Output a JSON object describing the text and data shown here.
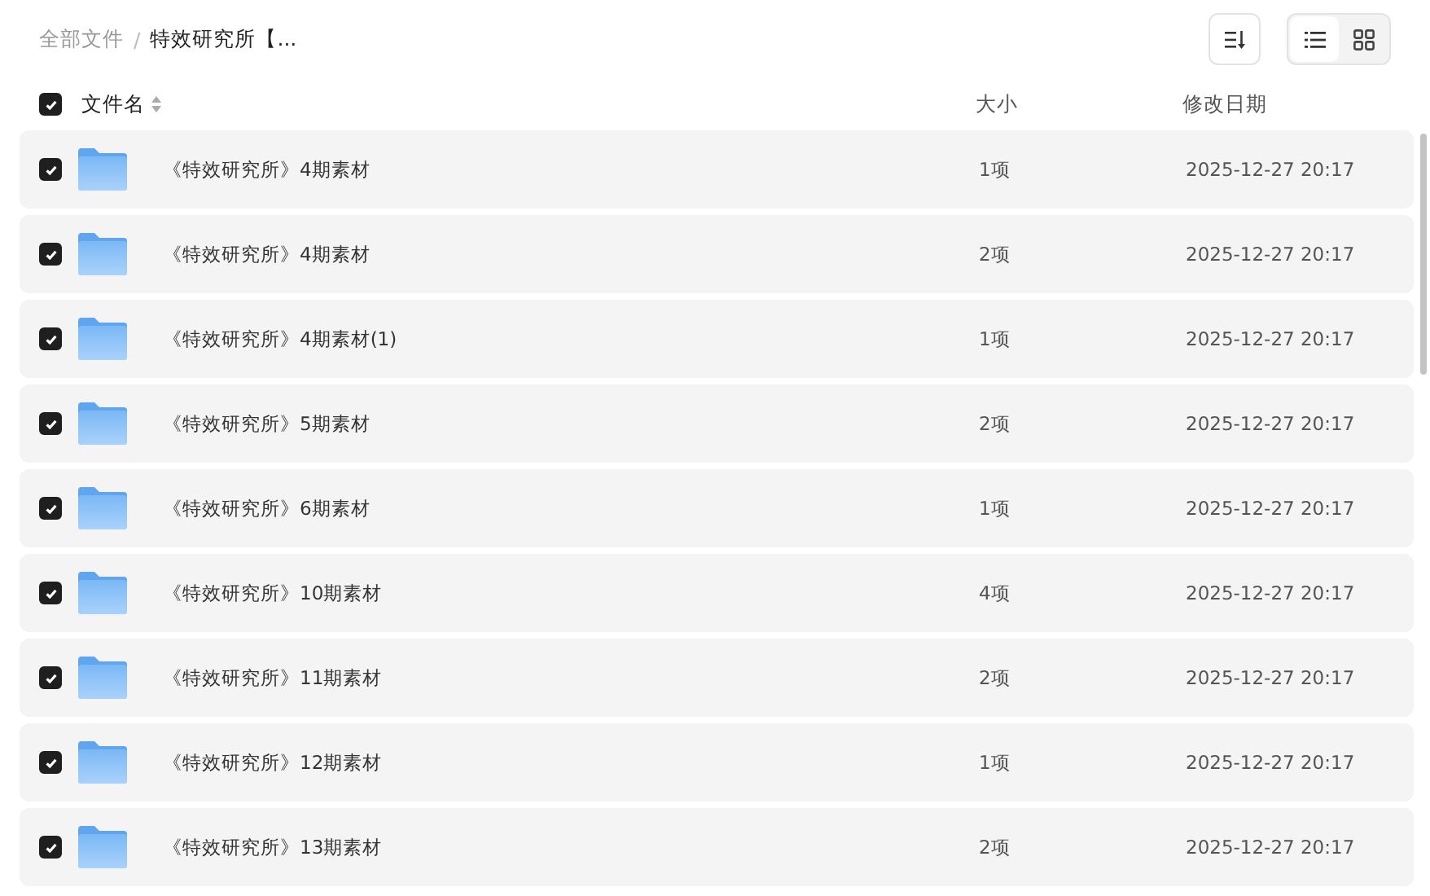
{
  "breadcrumb": [
    {
      "label": "全部文件",
      "current": false
    },
    {
      "label": "特效研究所【...",
      "current": true
    }
  ],
  "breadcrumb_separator": "/",
  "toolbar": {
    "views": [
      {
        "kind": "list",
        "selected": true
      },
      {
        "kind": "grid",
        "selected": false
      }
    ]
  },
  "table": {
    "select_all": {
      "checked": true
    },
    "columns": [
      {
        "label": "文件名",
        "sortable": true
      },
      {
        "label": "大小"
      },
      {
        "label": "修改日期"
      }
    ],
    "rows": [
      {
        "name": "《特效研究所》4期素材",
        "size": "1项",
        "modified": "2025-12-27 20:17",
        "checked": true
      },
      {
        "name": "《特效研究所》4期素材",
        "size": "2项",
        "modified": "2025-12-27 20:17",
        "checked": true
      },
      {
        "name": "《特效研究所》4期素材(1)",
        "size": "1项",
        "modified": "2025-12-27 20:17",
        "checked": true
      },
      {
        "name": "《特效研究所》5期素材",
        "size": "2项",
        "modified": "2025-12-27 20:17",
        "checked": true
      },
      {
        "name": "《特效研究所》6期素材",
        "size": "1项",
        "modified": "2025-12-27 20:17",
        "checked": true
      },
      {
        "name": "《特效研究所》10期素材",
        "size": "4项",
        "modified": "2025-12-27 20:17",
        "checked": true
      },
      {
        "name": "《特效研究所》11期素材",
        "size": "2项",
        "modified": "2025-12-27 20:17",
        "checked": true
      },
      {
        "name": "《特效研究所》12期素材",
        "size": "1项",
        "modified": "2025-12-27 20:17",
        "checked": true
      },
      {
        "name": "《特效研究所》13期素材",
        "size": "2项",
        "modified": "2025-12-27 20:17",
        "checked": true
      }
    ]
  }
}
